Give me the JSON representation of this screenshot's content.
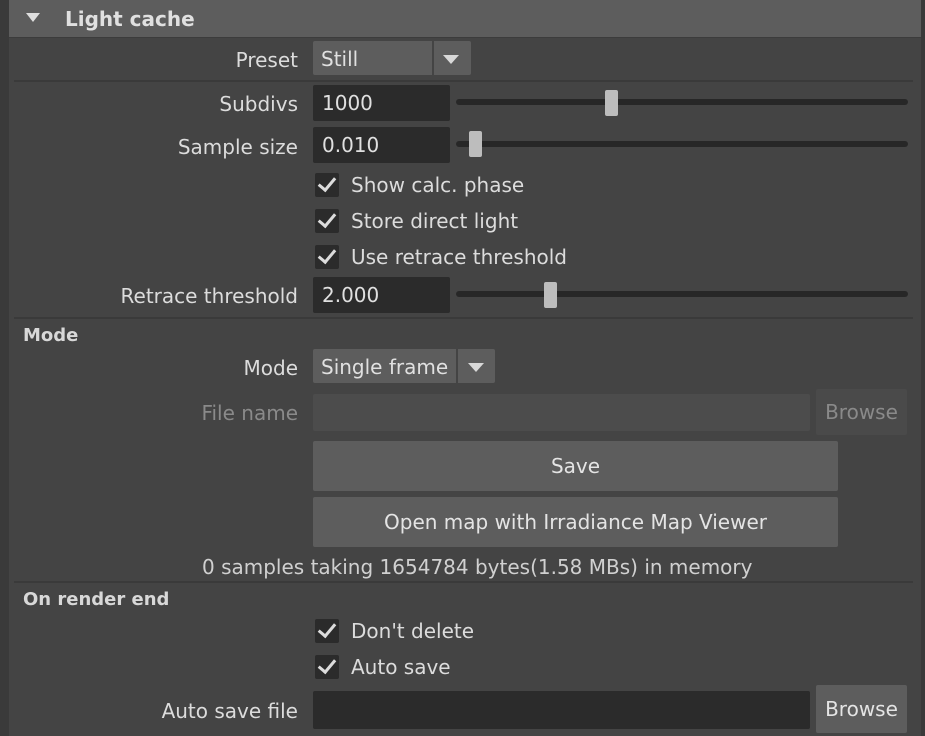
{
  "header": {
    "title": "Light cache"
  },
  "preset": {
    "label": "Preset",
    "value": "Still"
  },
  "subdivs": {
    "label": "Subdivs",
    "value": "1000",
    "slider_fraction": 0.34
  },
  "sample_size": {
    "label": "Sample size",
    "value": "0.010",
    "slider_fraction": 0.03
  },
  "checkboxes_top": [
    {
      "label": "Show calc. phase",
      "checked": true
    },
    {
      "label": "Store direct light",
      "checked": true
    },
    {
      "label": "Use retrace threshold",
      "checked": true
    }
  ],
  "retrace": {
    "label": "Retrace threshold",
    "value": "2.000",
    "slider_fraction": 0.2
  },
  "mode_section": {
    "title": "Mode",
    "mode": {
      "label": "Mode",
      "value": "Single frame"
    },
    "file_name": {
      "label": "File name",
      "value": "",
      "browse": "Browse"
    },
    "save_button": "Save",
    "open_viewer_button": "Open map with Irradiance Map Viewer",
    "memory_info": "0 samples taking 1654784 bytes(1.58 MBs) in memory"
  },
  "render_end_section": {
    "title": "On render end",
    "checkboxes": [
      {
        "label": "Don't delete",
        "checked": true
      },
      {
        "label": "Auto save",
        "checked": true
      }
    ],
    "auto_save_file": {
      "label": "Auto save file",
      "value": "",
      "browse": "Browse"
    }
  }
}
